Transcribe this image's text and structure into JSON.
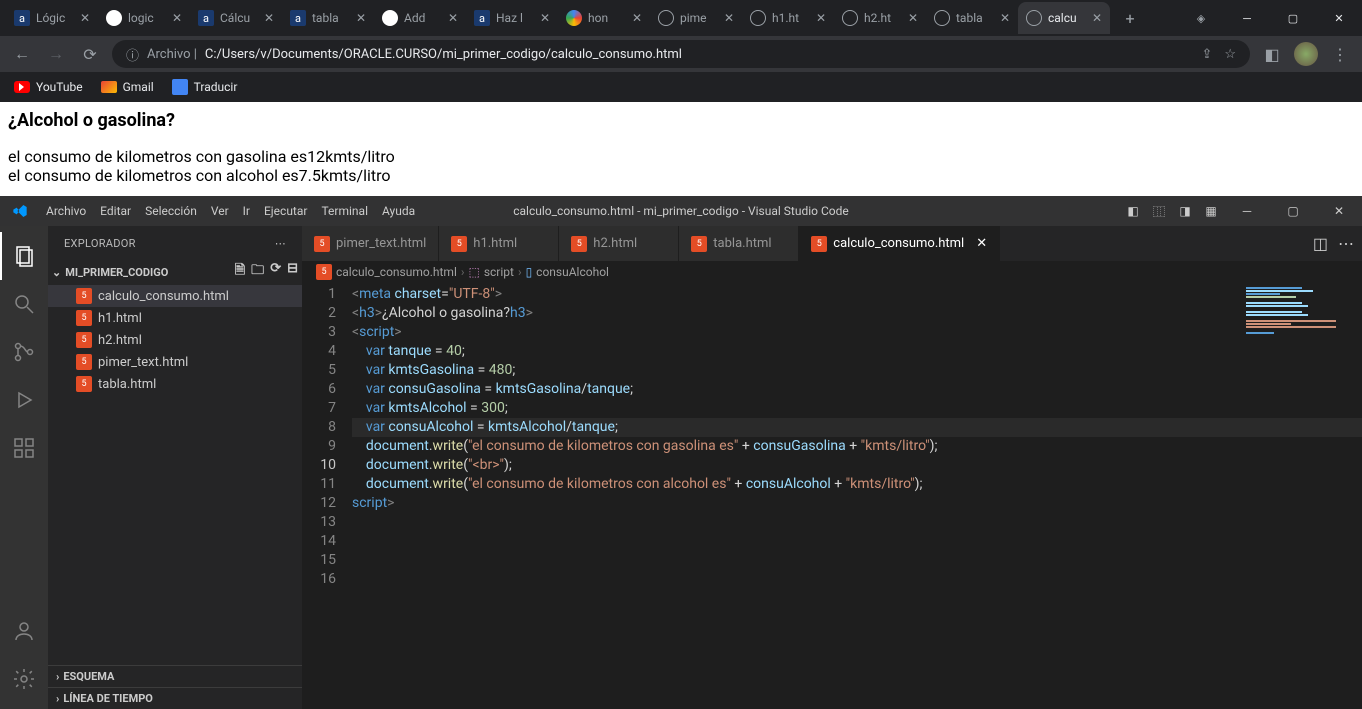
{
  "chrome": {
    "tabs": [
      {
        "title": "Lógic",
        "kind": "a"
      },
      {
        "title": "logic",
        "kind": "gh"
      },
      {
        "title": "Cálcu",
        "kind": "a"
      },
      {
        "title": "tabla",
        "kind": "a"
      },
      {
        "title": "Add",
        "kind": "gh"
      },
      {
        "title": "Haz l",
        "kind": "a"
      },
      {
        "title": "hon",
        "kind": "g"
      },
      {
        "title": "pime",
        "kind": "globe"
      },
      {
        "title": "h1.ht",
        "kind": "globe"
      },
      {
        "title": "h2.ht",
        "kind": "globe"
      },
      {
        "title": "tabla",
        "kind": "globe"
      },
      {
        "title": "calcu",
        "kind": "globe",
        "active": true
      }
    ],
    "url_prefix": "Archivo |",
    "url": "C:/Users/v/Documents/ORACLE.CURSO/mi_primer_codigo/calculo_consumo.html",
    "bookmarks": [
      {
        "label": "YouTube",
        "icon": "yt"
      },
      {
        "label": "Gmail",
        "icon": "gm"
      },
      {
        "label": "Traducir",
        "icon": "tr"
      }
    ]
  },
  "page": {
    "heading": "¿Alcohol o gasolina?",
    "line1": "el consumo de kilometros con gasolina es12kmts/litro",
    "line2": "el consumo de kilometros con alcohol es7.5kmts/litro"
  },
  "vscode": {
    "menus": [
      "Archivo",
      "Editar",
      "Selección",
      "Ver",
      "Ir",
      "Ejecutar",
      "Terminal",
      "Ayuda"
    ],
    "title": "calculo_consumo.html - mi_primer_codigo - Visual Studio Code",
    "explorer_label": "EXPLORADOR",
    "folder": "MI_PRIMER_CODIGO",
    "files": [
      "calculo_consumo.html",
      "h1.html",
      "h2.html",
      "pimer_text.html",
      "tabla.html"
    ],
    "active_file": "calculo_consumo.html",
    "bottom_sections": [
      "ESQUEMA",
      "LÍNEA DE TIEMPO"
    ],
    "editor_tabs": [
      "pimer_text.html",
      "h1.html",
      "h2.html",
      "tabla.html",
      "calculo_consumo.html"
    ],
    "active_tab": "calculo_consumo.html",
    "breadcrumb": [
      "calculo_consumo.html",
      "script",
      "consuAlcohol"
    ],
    "line_numbers": [
      "1",
      "2",
      "3",
      "4",
      "5",
      "6",
      "7",
      "8",
      "9",
      "10",
      "11",
      "12",
      "13",
      "14",
      "15",
      "16"
    ],
    "highlighted_line": 10,
    "code": {
      "l1": {
        "open": "<",
        "tag": "meta",
        "attr": " charset",
        "eq": "=",
        "str": "\"UTF-8\"",
        "close": ">"
      },
      "l2": {
        "open": "<",
        "tag": "h3",
        "close1": ">",
        "text": "¿Alcohol o gasolina?",
        "open2": "</",
        "tag2": "h3",
        "close2": ">"
      },
      "l3": {
        "open": "<",
        "tag": "script",
        "close": ">"
      },
      "l4": {
        "kw": "var",
        "sp": " ",
        "var": "tanque",
        "rest": " = ",
        "num": "40",
        "semi": ";"
      },
      "l6": {
        "kw": "var",
        "sp": " ",
        "var": "kmtsGasolina",
        "rest": " = ",
        "num": "480",
        "semi": ";"
      },
      "l7": {
        "kw": "var",
        "sp": " ",
        "var": "consuGasolina",
        "rest": " = ",
        "var2": "kmtsGasolina",
        "op": "/",
        "var3": "tanque",
        "semi": ";"
      },
      "l9": {
        "kw": "var",
        "sp": " ",
        "var": "kmtsAlcohol",
        "rest": " = ",
        "num": "300",
        "semi": ";"
      },
      "l10": {
        "kw": "var",
        "sp": " ",
        "var": "consuAlcohol",
        "rest": " = ",
        "var2": "kmtsAlcohol",
        "op": "/",
        "var3": "tanque",
        "semi": ";"
      },
      "l12": {
        "obj": "document",
        "dot": ".",
        "fn": "write",
        "open": "(",
        "str": "\"el consumo de kilometros con gasolina es\"",
        "plus": " + ",
        "var": "consuGasolina",
        "plus2": " + ",
        "str2": "\"kmts/litro\"",
        "close": ");"
      },
      "l13": {
        "obj": "document",
        "dot": ".",
        "fn": "write",
        "open": "(",
        "str": "\"<br>\"",
        "close": ");"
      },
      "l14": {
        "obj": "document",
        "dot": ".",
        "fn": "write",
        "open": "(",
        "str": "\"el consumo de kilometros con alcohol es\"",
        "plus": " + ",
        "var": "consuAlcohol",
        "plus2": " + ",
        "str2": "\"kmts/litro\"",
        "close": ");"
      },
      "l16": {
        "open": "</",
        "tag": "script",
        "close": ">"
      }
    }
  }
}
